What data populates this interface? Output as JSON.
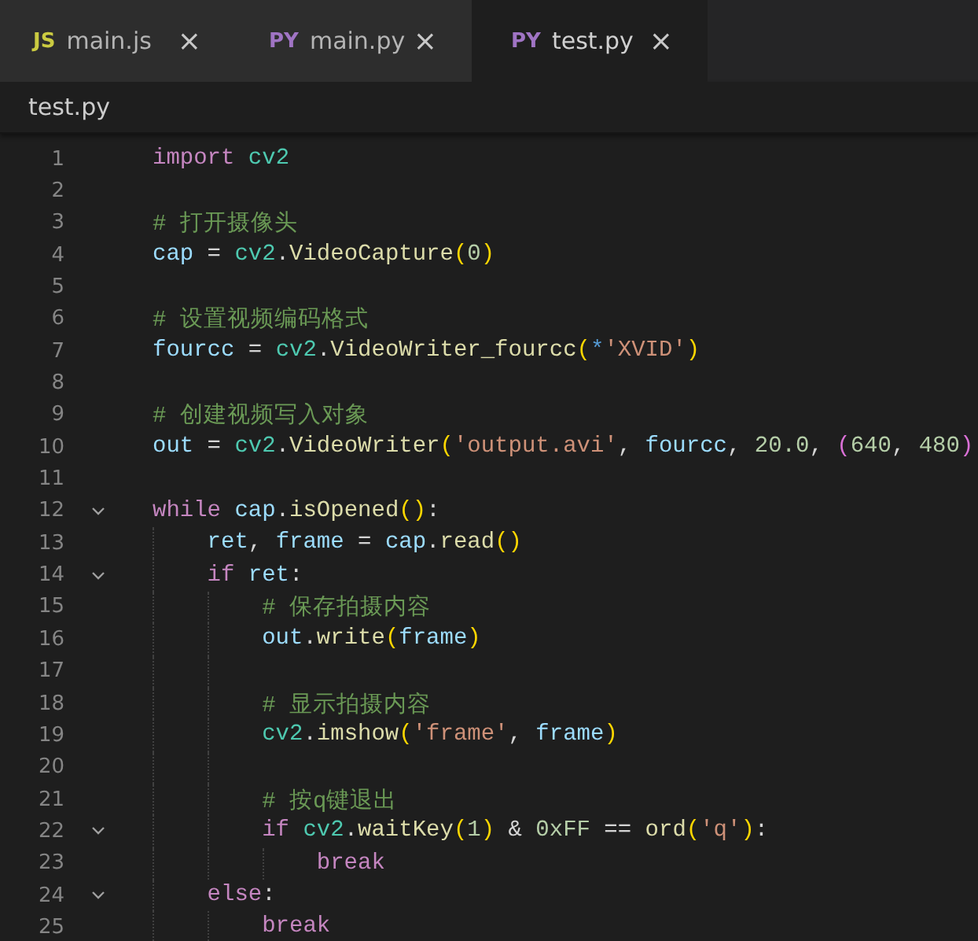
{
  "tabs": [
    {
      "badge": "JS",
      "color": "#cbcb41",
      "label": "main.js",
      "close": "×",
      "selected": false
    },
    {
      "badge": "PY",
      "color": "#a074c4",
      "label": "main.py",
      "close": "×",
      "selected": false
    },
    {
      "badge": "PY",
      "color": "#a074c4",
      "label": "test.py",
      "close": "×",
      "selected": true
    }
  ],
  "breadcrumb": "test.py",
  "lines": [
    {
      "number": "1",
      "fold": false,
      "tokens": [
        {
          "t": "import ",
          "color": "#c586c0"
        },
        {
          "t": "cv2",
          "color": "#4ec9b0"
        }
      ]
    },
    {
      "number": "2",
      "fold": false
    },
    {
      "number": "3",
      "fold": false,
      "tokens": [
        {
          "t": "# 打开摄像头",
          "color": "#6a9955"
        }
      ]
    },
    {
      "number": "4",
      "fold": false,
      "tokens": [
        {
          "t": "cap",
          "color": "#9cdcfe"
        },
        {
          "t": " = ",
          "color": "#d4d4d4"
        },
        {
          "t": "cv2",
          "color": "#4ec9b0"
        },
        {
          "t": ".",
          "color": "#d4d4d4"
        },
        {
          "t": "VideoCapture",
          "color": "#dcdcaa"
        },
        {
          "t": "(",
          "color": "#ffd700"
        },
        {
          "t": "0",
          "color": "#b5cea8"
        },
        {
          "t": ")",
          "color": "#ffd700"
        }
      ]
    },
    {
      "number": "5",
      "fold": false
    },
    {
      "number": "6",
      "fold": false,
      "tokens": [
        {
          "t": "# 设置视频编码格式",
          "color": "#6a9955"
        }
      ]
    },
    {
      "number": "7",
      "fold": false,
      "tokens": [
        {
          "t": "fourcc",
          "color": "#9cdcfe"
        },
        {
          "t": " = ",
          "color": "#d4d4d4"
        },
        {
          "t": "cv2",
          "color": "#4ec9b0"
        },
        {
          "t": ".",
          "color": "#d4d4d4"
        },
        {
          "t": "VideoWriter_fourcc",
          "color": "#dcdcaa"
        },
        {
          "t": "(",
          "color": "#ffd700"
        },
        {
          "t": "*",
          "color": "#569cd6"
        },
        {
          "t": "'XVID'",
          "color": "#ce9178"
        },
        {
          "t": ")",
          "color": "#ffd700"
        }
      ]
    },
    {
      "number": "8",
      "fold": false
    },
    {
      "number": "9",
      "fold": false,
      "tokens": [
        {
          "t": "# 创建视频写入对象",
          "color": "#6a9955"
        }
      ]
    },
    {
      "number": "10",
      "fold": false,
      "tokens": [
        {
          "t": "out",
          "color": "#9cdcfe"
        },
        {
          "t": " = ",
          "color": "#d4d4d4"
        },
        {
          "t": "cv2",
          "color": "#4ec9b0"
        },
        {
          "t": ".",
          "color": "#d4d4d4"
        },
        {
          "t": "VideoWriter",
          "color": "#dcdcaa"
        },
        {
          "t": "(",
          "color": "#ffd700"
        },
        {
          "t": "'output.avi'",
          "color": "#ce9178"
        },
        {
          "t": ", ",
          "color": "#d4d4d4"
        },
        {
          "t": "fourcc",
          "color": "#9cdcfe"
        },
        {
          "t": ", ",
          "color": "#d4d4d4"
        },
        {
          "t": "20.0",
          "color": "#b5cea8"
        },
        {
          "t": ", ",
          "color": "#d4d4d4"
        },
        {
          "t": "(",
          "color": "#da70d6"
        },
        {
          "t": "640",
          "color": "#b5cea8"
        },
        {
          "t": ", ",
          "color": "#d4d4d4"
        },
        {
          "t": "480",
          "color": "#b5cea8"
        },
        {
          "t": ")",
          "color": "#da70d6"
        }
      ]
    },
    {
      "number": "11",
      "fold": false
    },
    {
      "number": "12",
      "fold": true,
      "tokens": [
        {
          "t": "while ",
          "color": "#c586c0"
        },
        {
          "t": "cap",
          "color": "#9cdcfe"
        },
        {
          "t": ".",
          "color": "#d4d4d4"
        },
        {
          "t": "isOpened",
          "color": "#dcdcaa"
        },
        {
          "t": "()",
          "color": "#ffd700"
        },
        {
          "t": ":",
          "color": "#d4d4d4"
        }
      ],
      "children": [
        {
          "number": "13",
          "fold": false,
          "tokens": [
            {
              "t": "ret",
              "color": "#9cdcfe"
            },
            {
              "t": ", ",
              "color": "#d4d4d4"
            },
            {
              "t": "frame",
              "color": "#9cdcfe"
            },
            {
              "t": " = ",
              "color": "#d4d4d4"
            },
            {
              "t": "cap",
              "color": "#9cdcfe"
            },
            {
              "t": ".",
              "color": "#d4d4d4"
            },
            {
              "t": "read",
              "color": "#dcdcaa"
            },
            {
              "t": "()",
              "color": "#ffd700"
            }
          ]
        },
        {
          "number": "14",
          "fold": true,
          "tokens": [
            {
              "t": "if ",
              "color": "#c586c0"
            },
            {
              "t": "ret",
              "color": "#9cdcfe"
            },
            {
              "t": ":",
              "color": "#d4d4d4"
            }
          ],
          "children": [
            {
              "number": "15",
              "fold": false,
              "tokens": [
                {
                  "t": "# 保存拍摄内容",
                  "color": "#6a9955"
                }
              ]
            },
            {
              "number": "16",
              "fold": false,
              "tokens": [
                {
                  "t": "out",
                  "color": "#9cdcfe"
                },
                {
                  "t": ".",
                  "color": "#d4d4d4"
                },
                {
                  "t": "write",
                  "color": "#dcdcaa"
                },
                {
                  "t": "(",
                  "color": "#ffd700"
                },
                {
                  "t": "frame",
                  "color": "#9cdcfe"
                },
                {
                  "t": ")",
                  "color": "#ffd700"
                }
              ]
            },
            {
              "number": "17",
              "fold": false
            },
            {
              "number": "18",
              "fold": false,
              "tokens": [
                {
                  "t": "# 显示拍摄内容",
                  "color": "#6a9955"
                }
              ]
            },
            {
              "number": "19",
              "fold": false,
              "tokens": [
                {
                  "t": "cv2",
                  "color": "#4ec9b0"
                },
                {
                  "t": ".",
                  "color": "#d4d4d4"
                },
                {
                  "t": "imshow",
                  "color": "#dcdcaa"
                },
                {
                  "t": "(",
                  "color": "#ffd700"
                },
                {
                  "t": "'frame'",
                  "color": "#ce9178"
                },
                {
                  "t": ", ",
                  "color": "#d4d4d4"
                },
                {
                  "t": "frame",
                  "color": "#9cdcfe"
                },
                {
                  "t": ")",
                  "color": "#ffd700"
                }
              ]
            },
            {
              "number": "20",
              "fold": false
            },
            {
              "number": "21",
              "fold": false,
              "tokens": [
                {
                  "t": "# 按q键退出",
                  "color": "#6a9955"
                }
              ]
            },
            {
              "number": "22",
              "fold": true,
              "tokens": [
                {
                  "t": "if ",
                  "color": "#c586c0"
                },
                {
                  "t": "cv2",
                  "color": "#4ec9b0"
                },
                {
                  "t": ".",
                  "color": "#d4d4d4"
                },
                {
                  "t": "waitKey",
                  "color": "#dcdcaa"
                },
                {
                  "t": "(",
                  "color": "#ffd700"
                },
                {
                  "t": "1",
                  "color": "#b5cea8"
                },
                {
                  "t": ")",
                  "color": "#ffd700"
                },
                {
                  "t": " & ",
                  "color": "#d4d4d4"
                },
                {
                  "t": "0xFF",
                  "color": "#b5cea8"
                },
                {
                  "t": " == ",
                  "color": "#d4d4d4"
                },
                {
                  "t": "ord",
                  "color": "#dcdcaa"
                },
                {
                  "t": "(",
                  "color": "#ffd700"
                },
                {
                  "t": "'q'",
                  "color": "#ce9178"
                },
                {
                  "t": ")",
                  "color": "#ffd700"
                },
                {
                  "t": ":",
                  "color": "#d4d4d4"
                }
              ],
              "children": [
                {
                  "number": "23",
                  "fold": false,
                  "tokens": [
                    {
                      "t": "break",
                      "color": "#c586c0"
                    }
                  ]
                }
              ]
            }
          ]
        },
        {
          "number": "24",
          "fold": true,
          "tokens": [
            {
              "t": "else",
              "color": "#c586c0"
            },
            {
              "t": ":",
              "color": "#d4d4d4"
            }
          ],
          "children": [
            {
              "number": "25",
              "fold": false,
              "tokens": [
                {
                  "t": "break",
                  "color": "#c586c0"
                }
              ]
            }
          ]
        }
      ]
    }
  ]
}
